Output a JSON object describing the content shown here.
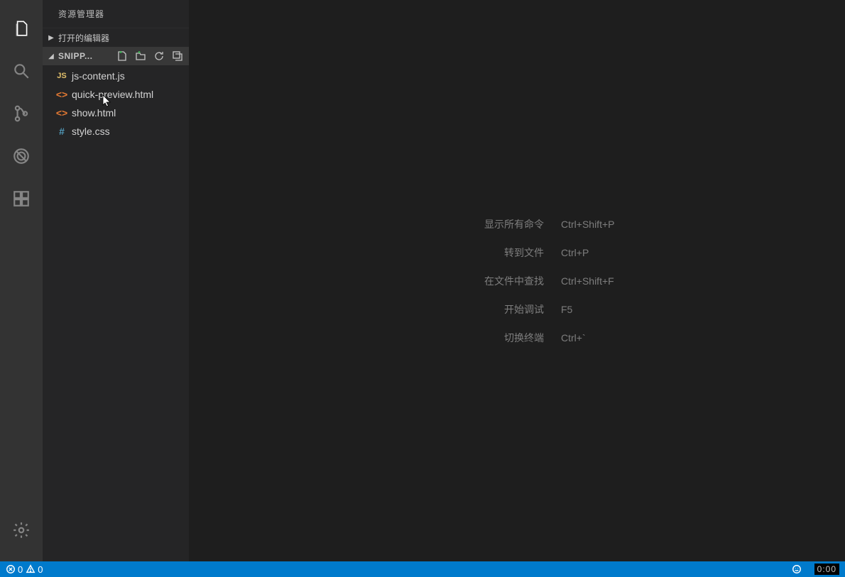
{
  "sidebar": {
    "title": "资源管理器",
    "openEditorsLabel": "打开的编辑器",
    "folderName": "SNIPP...",
    "files": [
      {
        "name": "js-content.js",
        "iconType": "js",
        "iconGlyph": "JS"
      },
      {
        "name": "quick-preview.html",
        "iconType": "html",
        "iconGlyph": "<>"
      },
      {
        "name": "show.html",
        "iconType": "html",
        "iconGlyph": "<>"
      },
      {
        "name": "style.css",
        "iconType": "css",
        "iconGlyph": "#"
      }
    ]
  },
  "welcome": {
    "hints": [
      {
        "label": "显示所有命令",
        "keys": "Ctrl+Shift+P"
      },
      {
        "label": "转到文件",
        "keys": "Ctrl+P"
      },
      {
        "label": "在文件中查找",
        "keys": "Ctrl+Shift+F"
      },
      {
        "label": "开始调试",
        "keys": "F5"
      },
      {
        "label": "切换终端",
        "keys": "Ctrl+`"
      }
    ]
  },
  "status": {
    "errors": "0",
    "warnings": "0",
    "time": "0:00"
  },
  "activity": {
    "icons": [
      "files-icon",
      "search-icon",
      "scm-icon",
      "debug-icon",
      "extensions-icon"
    ],
    "bottomIcons": [
      "gear-icon"
    ]
  }
}
